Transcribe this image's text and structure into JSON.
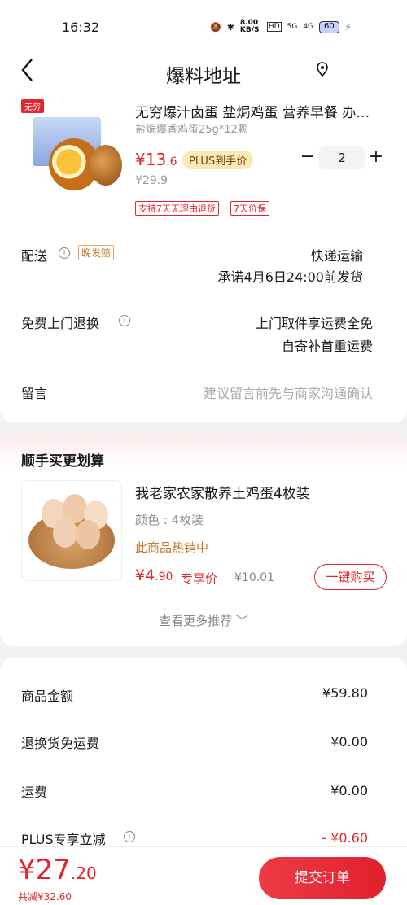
{
  "status_bar": {
    "time": "16:32",
    "net_speed": "8.00 KB/S",
    "hd": "HD",
    "sig1": "5G",
    "sig2": "4G",
    "battery": "60"
  },
  "header": {
    "title": "爆料地址"
  },
  "product": {
    "name": "无穷爆汁卤蛋 盐焗鸡蛋 营养早餐 办…",
    "spec": "盐焗爆香鸡蛋25g*12颗",
    "price_int": "¥13",
    "price_dec": ".6",
    "plus_badge": "PLUS到手价",
    "original_price": "¥29.9",
    "quantity": "2",
    "tags": [
      "支持7天无理由退货",
      "7天价保"
    ],
    "brand": "无穷"
  },
  "delivery": {
    "label": "配送",
    "badge": "晚发赔",
    "method": "快递运输",
    "promise": "承诺4月6日24:00前发货"
  },
  "return_service": {
    "label": "免费上门退换",
    "line1": "上门取件享运费全免",
    "line2": "自寄补首重运费"
  },
  "message": {
    "label": "留言",
    "placeholder": "建议留言前先与商家沟通确认"
  },
  "addon": {
    "section_title": "顺手买更划算",
    "name": "我老家农家散养土鸡蛋4枚装",
    "color_spec": "颜色 : 4枚装",
    "hot": "此商品热销中",
    "price_int": "¥4",
    "price_dec": ".90",
    "price_tag": "专享价",
    "orig_price": "¥10.01",
    "buy_label": "一键购买",
    "more_label": "查看更多推荐"
  },
  "summary": [
    {
      "label": "商品金额",
      "value": "¥59.80"
    },
    {
      "label": "退换货免运费",
      "value": "¥0.00"
    },
    {
      "label": "运费",
      "value": "¥0.00"
    },
    {
      "label": "PLUS专享立减",
      "value": "- ¥0.60"
    }
  ],
  "footer": {
    "total_int": "¥27",
    "total_dec": ".20",
    "saved": "共减¥32.60",
    "submit_label": "提交订单"
  },
  "colors": {
    "accent": "#e3262c",
    "gold": "#c8782a"
  }
}
